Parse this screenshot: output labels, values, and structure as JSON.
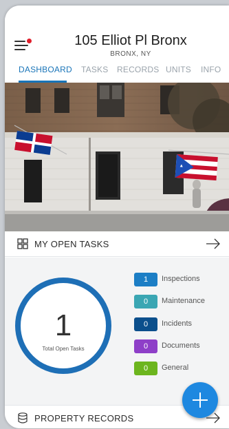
{
  "header": {
    "title": "105 Elliot Pl Bronx",
    "subtitle": "BRONX, NY"
  },
  "tabs": [
    {
      "label": "DASHBOARD",
      "active": true
    },
    {
      "label": "TASKS",
      "active": false
    },
    {
      "label": "RECORDS",
      "active": false
    },
    {
      "label": "UNITS",
      "active": false
    },
    {
      "label": "INFO",
      "active": false
    }
  ],
  "open_tasks": {
    "title": "MY OPEN TASKS",
    "total": "1",
    "total_label": "Total Open Tasks",
    "categories": [
      {
        "count": "1",
        "label": "Inspections",
        "color": "#1c7ec5"
      },
      {
        "count": "0",
        "label": "Maintenance",
        "color": "#3aa6b3"
      },
      {
        "count": "0",
        "label": "Incidents",
        "color": "#0b4f8c"
      },
      {
        "count": "0",
        "label": "Documents",
        "color": "#8e3fc8"
      },
      {
        "count": "0",
        "label": "General",
        "color": "#6cb51e"
      }
    ]
  },
  "property_records": {
    "title": "PROPERTY RECORDS"
  },
  "colors": {
    "accent": "#1874b8",
    "ring": "#1e6fb6",
    "fab": "#1e88e0",
    "notification": "#e01e2b"
  },
  "icons": {
    "menu": "menu-icon",
    "tasks": "grid-icon",
    "records": "database-icon",
    "arrow": "arrow-right-icon",
    "fab": "plus-icon"
  }
}
